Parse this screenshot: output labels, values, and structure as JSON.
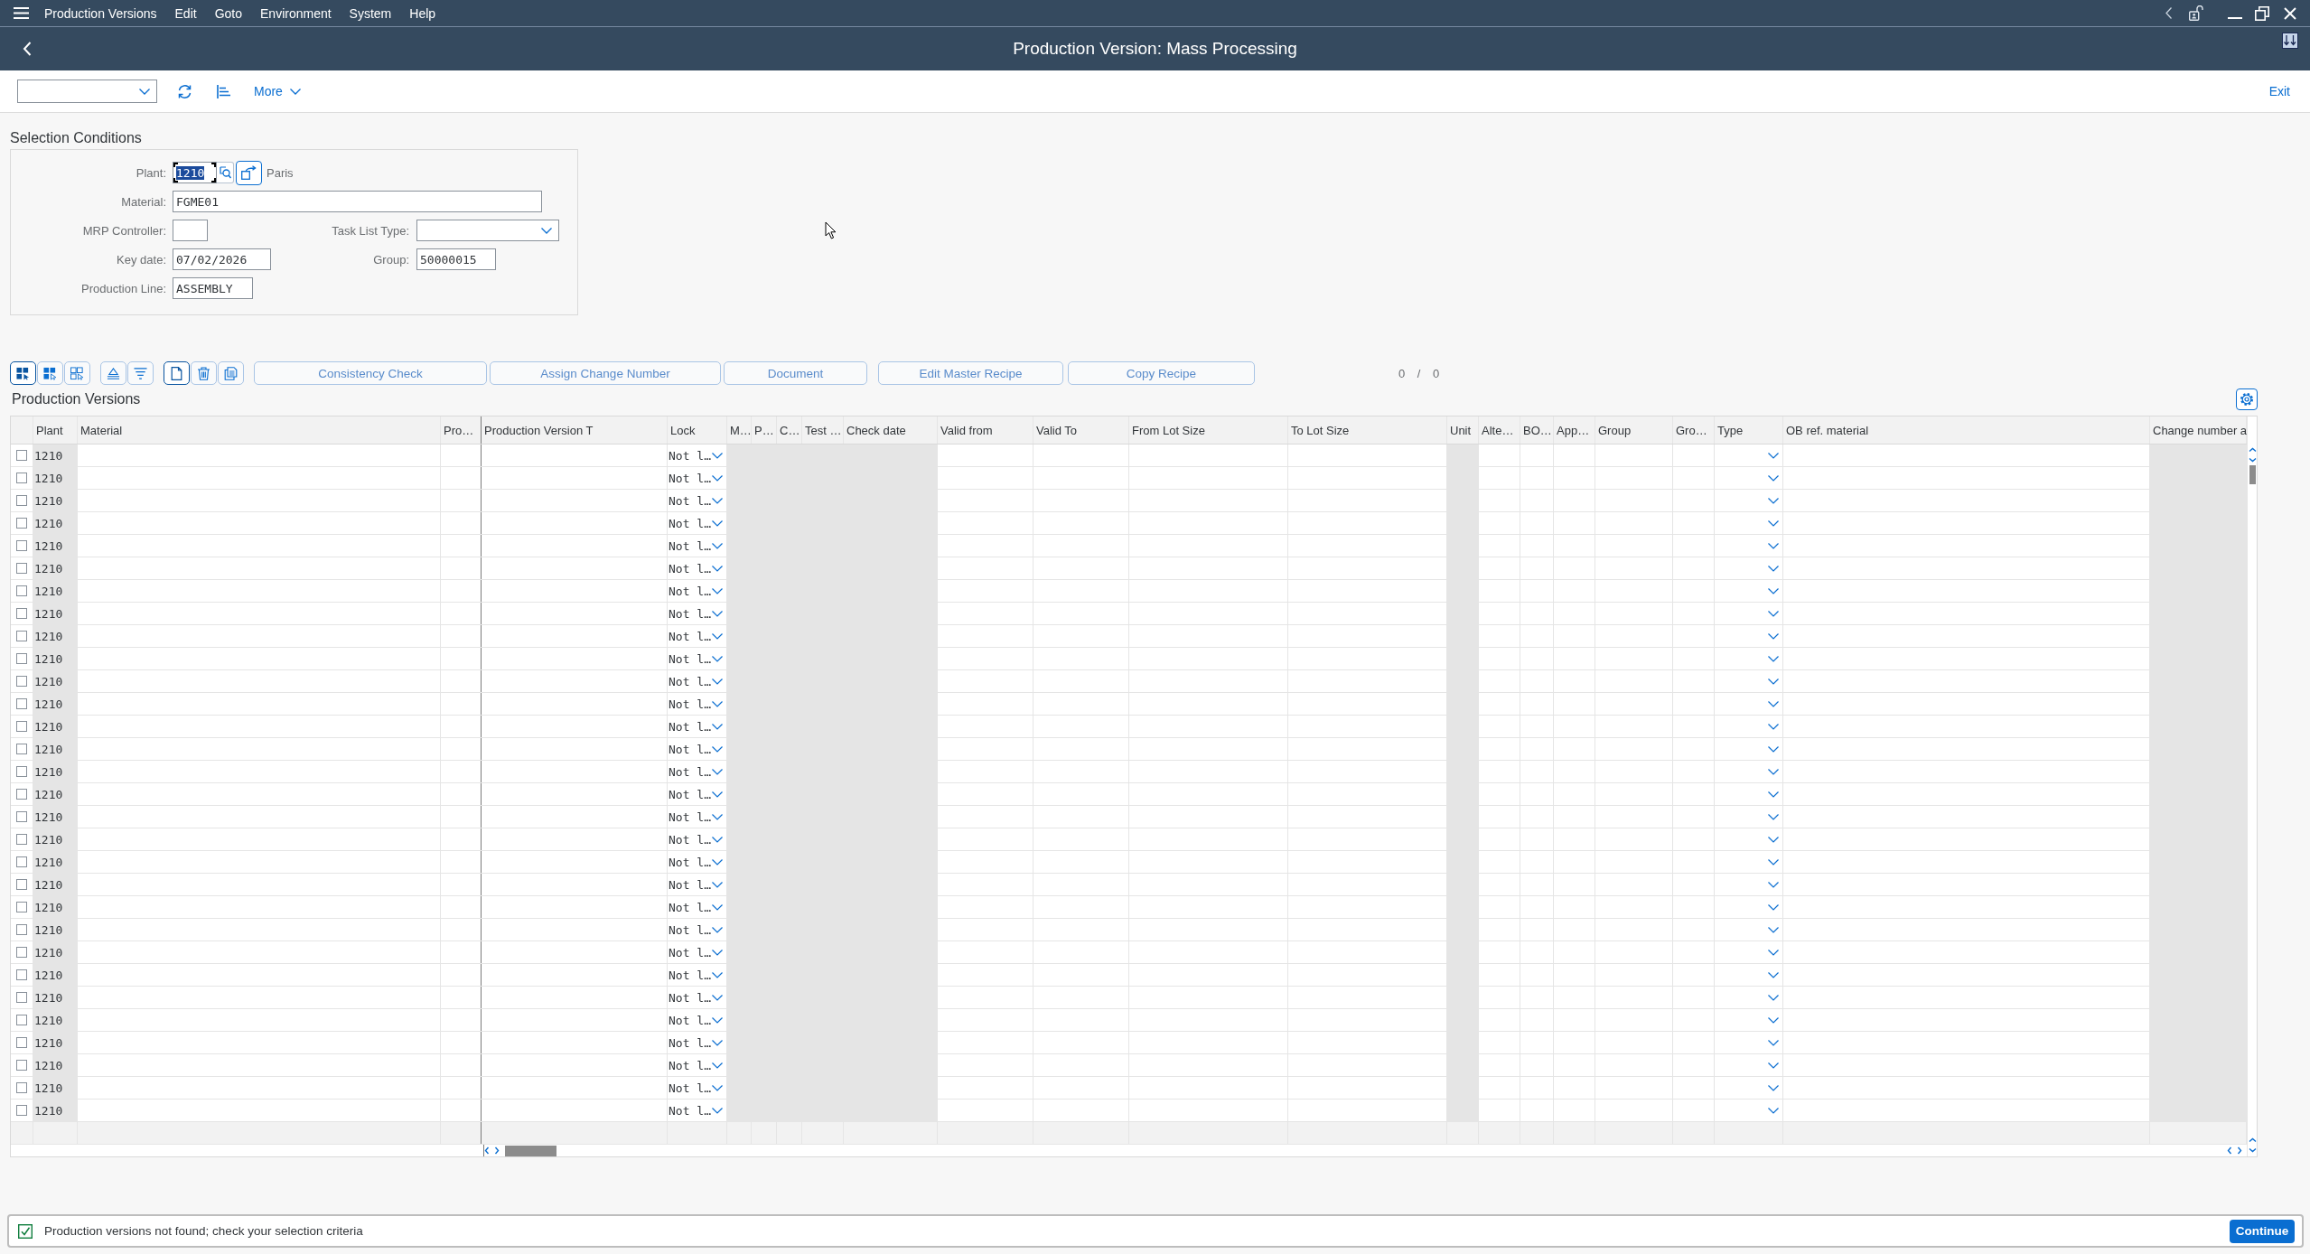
{
  "menu_bar": {
    "items": [
      "Production Versions",
      "Edit",
      "Goto",
      "Environment",
      "System",
      "Help"
    ]
  },
  "title_bar": {
    "title": "Production Version: Mass Processing"
  },
  "toolbar": {
    "more": "More",
    "exit": "Exit"
  },
  "selection_conditions": {
    "title": "Selection Conditions",
    "plant": {
      "label": "Plant:",
      "value": "1210",
      "focused": true,
      "description": "Paris"
    },
    "material": {
      "label": "Material:",
      "value": "FGME01"
    },
    "mrp_controller": {
      "label": "MRP Controller:"
    },
    "task_list_type": {
      "label": "Task List Type:"
    },
    "key_date": {
      "label": "Key date:",
      "value": "07/02/2026"
    },
    "group": {
      "label": "Group:",
      "value": "50000015"
    },
    "production_line": {
      "label": "Production Line:",
      "value": "ASSEMBLY"
    }
  },
  "table_toolbar": {
    "icon_buttons": [
      {
        "pressed": true
      },
      {
        "pressed": false
      },
      {
        "pressed": false
      },
      {
        "pressed": false
      },
      {
        "pressed": false
      },
      {
        "pressed": true
      },
      {
        "pressed": false
      },
      {
        "pressed": false
      }
    ],
    "buttons": [
      "Consistency Check",
      "Assign Change Number",
      "Document",
      "Edit Master Recipe",
      "Copy Recipe"
    ],
    "counter": "0 / 0"
  },
  "table": {
    "title": "Production Versions",
    "columns": [
      {
        "header": "Plant",
        "kind": "text",
        "editable": false
      },
      {
        "header": "Material",
        "kind": "text",
        "editable": true
      },
      {
        "header": "Pro…",
        "kind": "text",
        "editable": true
      },
      {
        "header": "Production Version T",
        "kind": "text",
        "editable": true
      },
      {
        "header": "Lock",
        "kind": "dropdown",
        "editable": true
      },
      {
        "header": "M…",
        "kind": "text",
        "editable": false
      },
      {
        "header": "P…",
        "kind": "text",
        "editable": false
      },
      {
        "header": "C…",
        "kind": "text",
        "editable": false
      },
      {
        "header": "Test …",
        "kind": "text",
        "editable": false
      },
      {
        "header": "Check date",
        "kind": "text",
        "editable": false
      },
      {
        "header": "Valid from",
        "kind": "text",
        "editable": true
      },
      {
        "header": "Valid To",
        "kind": "text",
        "editable": true
      },
      {
        "header": "From Lot Size",
        "kind": "text",
        "editable": true
      },
      {
        "header": "To Lot Size",
        "kind": "text",
        "editable": true
      },
      {
        "header": "Unit",
        "kind": "text",
        "editable": false
      },
      {
        "header": "Alte…",
        "kind": "text",
        "editable": true
      },
      {
        "header": "BO…",
        "kind": "text",
        "editable": true
      },
      {
        "header": "App…",
        "kind": "text",
        "editable": true
      },
      {
        "header": "Group",
        "kind": "text",
        "editable": true
      },
      {
        "header": "Gro…",
        "kind": "text",
        "editable": true
      },
      {
        "header": "Type",
        "kind": "dropdown",
        "editable": true
      },
      {
        "header": "OB ref. material",
        "kind": "text",
        "editable": true
      },
      {
        "header": "Change number a",
        "kind": "text",
        "editable": false
      }
    ],
    "rows": [
      {
        "selected": false,
        "plant": "1210",
        "lock": "Not l…"
      },
      {
        "selected": false,
        "plant": "1210",
        "lock": "Not l…"
      },
      {
        "selected": false,
        "plant": "1210",
        "lock": "Not l…"
      },
      {
        "selected": false,
        "plant": "1210",
        "lock": "Not l…"
      },
      {
        "selected": false,
        "plant": "1210",
        "lock": "Not l…"
      },
      {
        "selected": false,
        "plant": "1210",
        "lock": "Not l…"
      },
      {
        "selected": false,
        "plant": "1210",
        "lock": "Not l…"
      },
      {
        "selected": false,
        "plant": "1210",
        "lock": "Not l…"
      },
      {
        "selected": false,
        "plant": "1210",
        "lock": "Not l…"
      },
      {
        "selected": false,
        "plant": "1210",
        "lock": "Not l…"
      },
      {
        "selected": false,
        "plant": "1210",
        "lock": "Not l…"
      },
      {
        "selected": false,
        "plant": "1210",
        "lock": "Not l…"
      },
      {
        "selected": false,
        "plant": "1210",
        "lock": "Not l…"
      },
      {
        "selected": false,
        "plant": "1210",
        "lock": "Not l…"
      },
      {
        "selected": false,
        "plant": "1210",
        "lock": "Not l…"
      },
      {
        "selected": false,
        "plant": "1210",
        "lock": "Not l…"
      },
      {
        "selected": false,
        "plant": "1210",
        "lock": "Not l…"
      },
      {
        "selected": false,
        "plant": "1210",
        "lock": "Not l…"
      },
      {
        "selected": false,
        "plant": "1210",
        "lock": "Not l…"
      },
      {
        "selected": false,
        "plant": "1210",
        "lock": "Not l…"
      },
      {
        "selected": false,
        "plant": "1210",
        "lock": "Not l…"
      },
      {
        "selected": false,
        "plant": "1210",
        "lock": "Not l…"
      },
      {
        "selected": false,
        "plant": "1210",
        "lock": "Not l…"
      },
      {
        "selected": false,
        "plant": "1210",
        "lock": "Not l…"
      },
      {
        "selected": false,
        "plant": "1210",
        "lock": "Not l…"
      },
      {
        "selected": false,
        "plant": "1210",
        "lock": "Not l…"
      },
      {
        "selected": false,
        "plant": "1210",
        "lock": "Not l…"
      },
      {
        "selected": false,
        "plant": "1210",
        "lock": "Not l…"
      },
      {
        "selected": false,
        "plant": "1210",
        "lock": "Not l…"
      },
      {
        "selected": false,
        "plant": "1210",
        "lock": "Not l…"
      }
    ]
  },
  "message_bar": {
    "kind": "success",
    "text": "Production versions not found; check your selection criteria",
    "button": "Continue"
  }
}
